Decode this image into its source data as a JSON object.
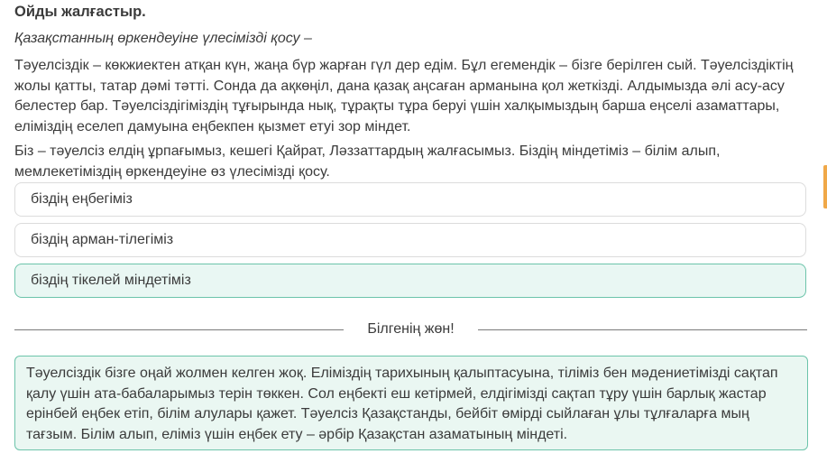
{
  "task": {
    "title": "Ойды жалғастыр.",
    "subtitle": "Қазақстанның өркендеуіне үлесімізді қосу –",
    "paragraph1": "Тәуелсіздік – көкжиектен атқан күн, жаңа бүр жарған гүл дер едім. Бұл егемендік – бізге берілген сый. Тәуелсіздіктің жолы қатты, татар дәмі тәтті. Сонда да ақкөңіл, дана қазақ аңсаған арманына қол жеткізді. Алдымызда әлі асу-асу белестер бар. Тәуелсіздігіміздің тұғырында нық, тұрақты тұра беруі үшін халқымыздың барша еңселі азаматтары, еліміздің еселеп дамуына еңбекпен қызмет етуі зор міндет.",
    "paragraph2": "Біз – тәуелсіз елдің ұрпағымыз, кешегі Қайрат, Ләззаттардың жалғасымыз. Біздің міндетіміз – білім алып, мемлекетіміздің өркендеуіне өз үлесімізді қосу."
  },
  "options": [
    {
      "label": "біздің еңбегіміз",
      "selected": false
    },
    {
      "label": "біздің арман-тілегіміз",
      "selected": false
    },
    {
      "label": "біздің тікелей міндетіміз",
      "selected": true
    }
  ],
  "info_section": {
    "heading": "Білгенің жөн!",
    "text": "Тәуелсіздік бізге оңай жолмен келген жоқ. Еліміздің тарихының қалыптасуына, тіліміз бен мәдениетімізді сақтап қалу үшін ата-бабаларымыз терін төккен. Сол еңбекті еш кетірмей, елдігімізді сақтап тұру үшін барлық жастар ерінбей еңбек етіп, білім алулары қажет. Тәуелсіз Қазақстанды, бейбіт өмірді сыйлаған ұлы тұлғаларға мың тағзым. Білім алып, еліміз үшін еңбек ету – әрбір Қазақстан азаматының міндеті."
  },
  "colors": {
    "selected_bg": "#e9f7f3",
    "selected_border": "#6cc4aa",
    "info_bg": "#eaf7f2",
    "edge_tab": "#f0a848"
  }
}
